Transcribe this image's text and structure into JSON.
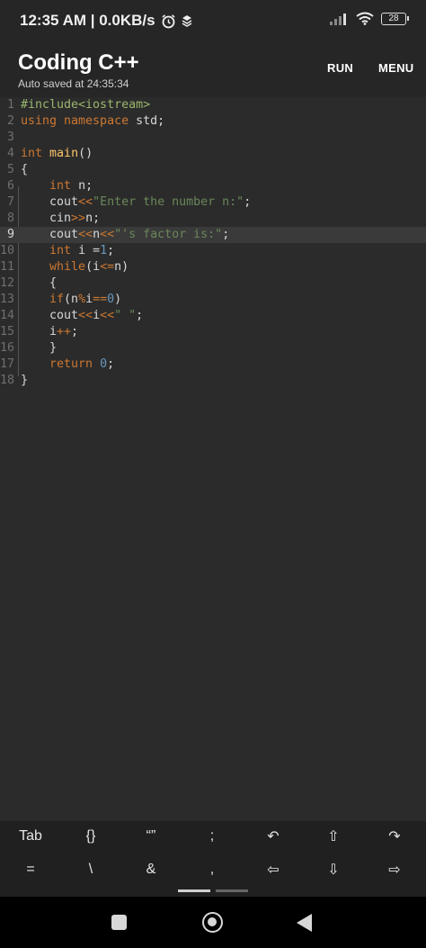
{
  "status_bar": {
    "time_speed": "12:35 AM | 0.0KB/s",
    "battery": "28"
  },
  "header": {
    "title": "Coding C++",
    "subtitle": "Auto saved at 24:35:34",
    "run_label": "RUN",
    "menu_label": "MENU"
  },
  "editor": {
    "active_line": 9,
    "lines": [
      {
        "n": "1",
        "tokens": [
          [
            "pp",
            "#include<iostream>"
          ]
        ]
      },
      {
        "n": "2",
        "tokens": [
          [
            "kw",
            "using namespace"
          ],
          [
            "plain",
            " std;"
          ]
        ]
      },
      {
        "n": "3",
        "tokens": []
      },
      {
        "n": "4",
        "tokens": [
          [
            "kw",
            "int"
          ],
          [
            "plain",
            " "
          ],
          [
            "fn",
            "main"
          ],
          [
            "plain",
            "()"
          ]
        ]
      },
      {
        "n": "5",
        "tokens": [
          [
            "plain",
            "{"
          ]
        ]
      },
      {
        "n": "6",
        "tokens": [
          [
            "plain",
            "    "
          ],
          [
            "kw",
            "int"
          ],
          [
            "plain",
            " n;"
          ]
        ]
      },
      {
        "n": "7",
        "tokens": [
          [
            "plain",
            "    cout"
          ],
          [
            "op",
            "<<"
          ],
          [
            "str",
            "\"Enter the number n:\""
          ],
          [
            "plain",
            ";"
          ]
        ]
      },
      {
        "n": "8",
        "tokens": [
          [
            "plain",
            "    cin"
          ],
          [
            "op",
            ">>"
          ],
          [
            "plain",
            "n;"
          ]
        ]
      },
      {
        "n": "9",
        "tokens": [
          [
            "plain",
            "    cout"
          ],
          [
            "op",
            "<<"
          ],
          [
            "plain",
            "n"
          ],
          [
            "op",
            "<<"
          ],
          [
            "str",
            "\"'s factor is:\""
          ],
          [
            "plain",
            ";"
          ]
        ]
      },
      {
        "n": "10",
        "tokens": [
          [
            "plain",
            "    "
          ],
          [
            "kw",
            "int"
          ],
          [
            "plain",
            " i ="
          ],
          [
            "num",
            "1"
          ],
          [
            "plain",
            ";"
          ]
        ]
      },
      {
        "n": "11",
        "tokens": [
          [
            "plain",
            "    "
          ],
          [
            "kw",
            "while"
          ],
          [
            "plain",
            "(i"
          ],
          [
            "op",
            "<="
          ],
          [
            "plain",
            "n)"
          ]
        ]
      },
      {
        "n": "12",
        "tokens": [
          [
            "plain",
            "    {"
          ]
        ]
      },
      {
        "n": "13",
        "tokens": [
          [
            "plain",
            "    "
          ],
          [
            "kw",
            "if"
          ],
          [
            "plain",
            "(n"
          ],
          [
            "op",
            "%"
          ],
          [
            "plain",
            "i"
          ],
          [
            "op",
            "=="
          ],
          [
            "num",
            "0"
          ],
          [
            "plain",
            ")"
          ]
        ]
      },
      {
        "n": "14",
        "tokens": [
          [
            "plain",
            "    cout"
          ],
          [
            "op",
            "<<"
          ],
          [
            "plain",
            "i"
          ],
          [
            "op",
            "<<"
          ],
          [
            "str",
            "\" \""
          ],
          [
            "plain",
            ";"
          ]
        ]
      },
      {
        "n": "15",
        "tokens": [
          [
            "plain",
            "    i"
          ],
          [
            "op",
            "++"
          ],
          [
            "plain",
            ";"
          ]
        ]
      },
      {
        "n": "16",
        "tokens": [
          [
            "plain",
            "    }"
          ]
        ]
      },
      {
        "n": "17",
        "tokens": [
          [
            "plain",
            "    "
          ],
          [
            "kw",
            "return"
          ],
          [
            "plain",
            " "
          ],
          [
            "num",
            "0"
          ],
          [
            "plain",
            ";"
          ]
        ]
      },
      {
        "n": "18",
        "tokens": [
          [
            "plain",
            "}"
          ]
        ]
      }
    ]
  },
  "toolbar": {
    "row1": [
      {
        "name": "tab-key",
        "label": "Tab"
      },
      {
        "name": "braces-key",
        "label": "{}"
      },
      {
        "name": "quotes-key",
        "label": "“”"
      },
      {
        "name": "semicolon-key",
        "label": ";"
      },
      {
        "name": "undo-key",
        "label": "↶"
      },
      {
        "name": "shift-up-key",
        "label": "⇧"
      },
      {
        "name": "redo-key",
        "label": "↷"
      }
    ],
    "row2": [
      {
        "name": "equals-key",
        "label": "="
      },
      {
        "name": "backslash-key",
        "label": "\\"
      },
      {
        "name": "ampersand-key",
        "label": "&"
      },
      {
        "name": "comma-key",
        "label": ","
      },
      {
        "name": "left-arrow-key",
        "label": "⇦"
      },
      {
        "name": "down-arrow-key",
        "label": "⇩"
      },
      {
        "name": "right-arrow-key",
        "label": "⇨"
      }
    ]
  },
  "colors": {
    "keyword": "#cc7832",
    "string": "#6a8759",
    "number": "#6897bb",
    "function": "#ffc66d",
    "include": "#9ab76d"
  }
}
